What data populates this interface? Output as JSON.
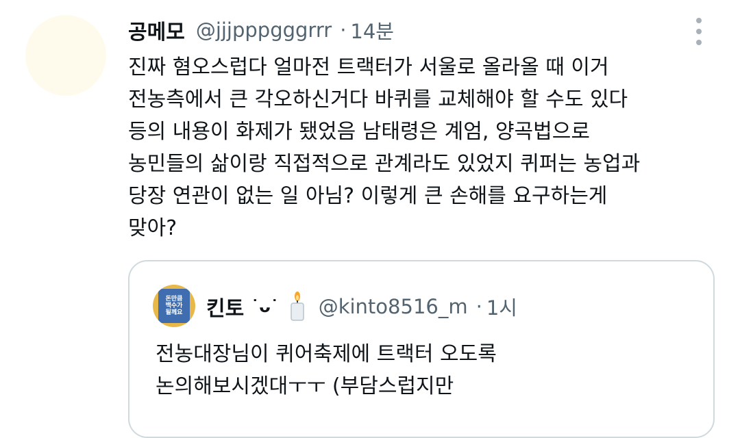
{
  "tweet": {
    "author_name": "공메모",
    "author_handle": "@jjjpppgggrrr",
    "separator": "·",
    "time": "14분",
    "lines": [
      "진짜 혐오스럽다 얼마전 트랙터가 서울로 올라올 때 이거",
      "전농측에서 큰 각오하신거다 바퀴를 교체해야 할 수도 있다",
      "등의 내용이 화제가 됐었음 남태령은 계엄, 양곡법으로",
      "농민들의 삶이랑 직접적으로 관계라도 있었지 퀴퍼는 농업과",
      "당장 연관이 없는 일 아님? 이렇게 큰 손해를 요구하는게",
      "맞아?"
    ]
  },
  "quoted_tweet": {
    "avatar_text": [
      "돈만큼",
      "백수가",
      "될께요"
    ],
    "author_name": "킨토",
    "author_emoji": "˙ᴗ˙",
    "candle_icon": "candle-icon",
    "author_handle": "@kinto8516_m",
    "separator": "·",
    "time": "1시",
    "lines": [
      "전농대장님이 퀴어축제에 트랙터 오도록",
      "논의해보시겠대ㅜㅜ (부담스럽지만"
    ]
  },
  "icons": {
    "more": "more-vertical-icon"
  },
  "colors": {
    "text": "#0f1419",
    "secondary": "#536471",
    "border": "#cfd9de",
    "avatar_bg": "#fffbec"
  }
}
